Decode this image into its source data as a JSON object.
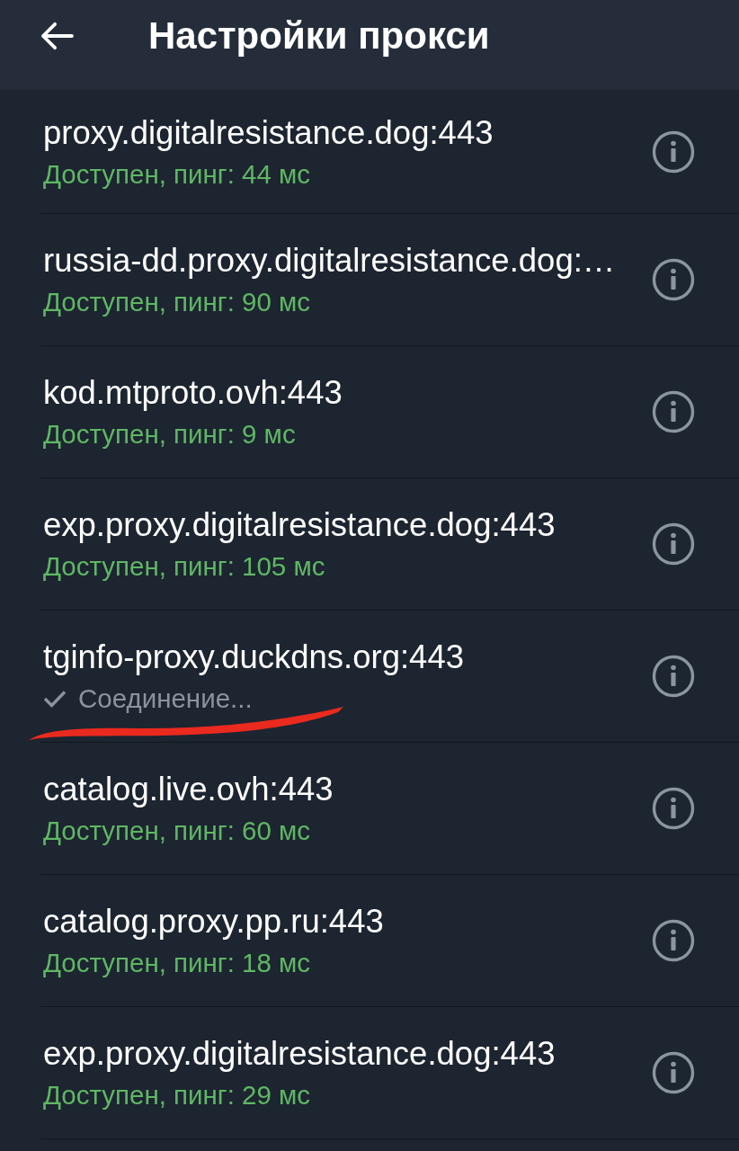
{
  "header": {
    "title": "Настройки прокси"
  },
  "proxies": [
    {
      "host": "proxy.digitalresistance.dog:443",
      "status": "Доступен, пинг: 44 мс",
      "kind": "available",
      "selected": false,
      "annotated": false
    },
    {
      "host": "russia-dd.proxy.digitalresistance.dog:…",
      "status": "Доступен, пинг: 90 мс",
      "kind": "available",
      "selected": false,
      "annotated": false
    },
    {
      "host": "kod.mtproto.ovh:443",
      "status": "Доступен, пинг: 9 мс",
      "kind": "available",
      "selected": false,
      "annotated": false
    },
    {
      "host": "exp.proxy.digitalresistance.dog:443",
      "status": "Доступен, пинг: 105 мс",
      "kind": "available",
      "selected": false,
      "annotated": false
    },
    {
      "host": "tginfo-proxy.duckdns.org:443",
      "status": "Соединение...",
      "kind": "connecting",
      "selected": true,
      "annotated": true
    },
    {
      "host": "catalog.live.ovh:443",
      "status": "Доступен, пинг: 60 мс",
      "kind": "available",
      "selected": false,
      "annotated": false
    },
    {
      "host": "catalog.proxy.pp.ru:443",
      "status": "Доступен, пинг: 18 мс",
      "kind": "available",
      "selected": false,
      "annotated": false
    },
    {
      "host": "exp.proxy.digitalresistance.dog:443",
      "status": "Доступен, пинг: 29 мс",
      "kind": "available",
      "selected": false,
      "annotated": false
    }
  ]
}
